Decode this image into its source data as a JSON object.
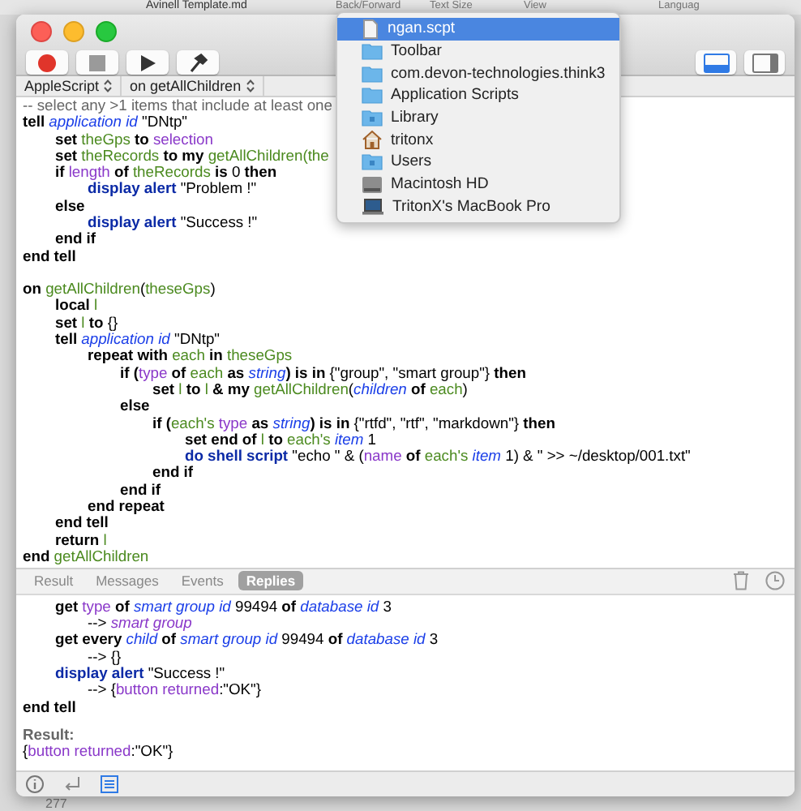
{
  "background_window": {
    "file_name": "Avinell Template.md",
    "toolbar_labels": [
      "Back/Forward",
      "Text Size",
      "View",
      "Languag"
    ],
    "line_number": "277"
  },
  "window": {
    "toolbar_buttons": [
      {
        "kind": "record"
      },
      {
        "kind": "stop"
      },
      {
        "kind": "run"
      },
      {
        "kind": "compile"
      }
    ],
    "view_buttons": [
      {
        "kind": "bottom-pane",
        "selected": true
      },
      {
        "kind": "side-pane",
        "selected": false
      }
    ],
    "selectors": [
      "AppleScript",
      "on getAllChildren"
    ],
    "code": [
      {
        "tokens": [
          {
            "t": "-- select any >1 items that include at least one",
            "kind": "comment"
          }
        ]
      },
      {
        "tokens": [
          {
            "t": "tell ",
            "kind": "kw"
          },
          {
            "t": "application id",
            "kind": "class"
          },
          {
            "t": " \"DNtp\"",
            "kind": "plain"
          }
        ]
      },
      {
        "tokens": [
          {
            "t": "\tset ",
            "kind": "kw"
          },
          {
            "t": "theGps",
            "kind": "var"
          },
          {
            "t": " to ",
            "kind": "kw"
          },
          {
            "t": "selection",
            "kind": "prop"
          }
        ]
      },
      {
        "tokens": [
          {
            "t": "\tset ",
            "kind": "kw"
          },
          {
            "t": "theRecords",
            "kind": "var"
          },
          {
            "t": " to my ",
            "kind": "kw"
          },
          {
            "t": "getAllChildren(the",
            "kind": "var"
          }
        ]
      },
      {
        "tokens": [
          {
            "t": "\tif ",
            "kind": "kw"
          },
          {
            "t": "length",
            "kind": "prop"
          },
          {
            "t": " of ",
            "kind": "kw"
          },
          {
            "t": "theRecords",
            "kind": "var"
          },
          {
            "t": " is ",
            "kind": "kw"
          },
          {
            "t": "0",
            "kind": "plain"
          },
          {
            "t": " then",
            "kind": "kw"
          }
        ]
      },
      {
        "tokens": [
          {
            "t": "\t\tdisplay alert",
            "kind": "cmd"
          },
          {
            "t": " \"Problem !\"",
            "kind": "plain"
          }
        ]
      },
      {
        "tokens": [
          {
            "t": "\telse",
            "kind": "kw"
          }
        ]
      },
      {
        "tokens": [
          {
            "t": "\t\tdisplay alert",
            "kind": "cmd"
          },
          {
            "t": " \"Success !\"",
            "kind": "plain"
          }
        ]
      },
      {
        "tokens": [
          {
            "t": "\tend if",
            "kind": "kw"
          }
        ]
      },
      {
        "tokens": [
          {
            "t": "end tell",
            "kind": "kw"
          }
        ]
      },
      {
        "spaced": true,
        "tokens": [
          {
            "t": "on ",
            "kind": "kw"
          },
          {
            "t": "getAllChildren",
            "kind": "var"
          },
          {
            "t": "(",
            "kind": "plain"
          },
          {
            "t": "theseGps",
            "kind": "var"
          },
          {
            "t": ")",
            "kind": "plain"
          }
        ]
      },
      {
        "tokens": [
          {
            "t": "\tlocal ",
            "kind": "kw"
          },
          {
            "t": "l",
            "kind": "var"
          }
        ]
      },
      {
        "tokens": [
          {
            "t": "\tset ",
            "kind": "kw"
          },
          {
            "t": "l",
            "kind": "var"
          },
          {
            "t": " to ",
            "kind": "kw"
          },
          {
            "t": "{}",
            "kind": "plain"
          }
        ]
      },
      {
        "tokens": [
          {
            "t": "\ttell ",
            "kind": "kw"
          },
          {
            "t": "application id",
            "kind": "class"
          },
          {
            "t": " \"DNtp\"",
            "kind": "plain"
          }
        ]
      },
      {
        "tokens": [
          {
            "t": "\t\trepeat with ",
            "kind": "kw"
          },
          {
            "t": "each",
            "kind": "var"
          },
          {
            "t": " in ",
            "kind": "kw"
          },
          {
            "t": "theseGps",
            "kind": "var"
          }
        ]
      },
      {
        "tokens": [
          {
            "t": "\t\t\tif (",
            "kind": "kw"
          },
          {
            "t": "type",
            "kind": "prop"
          },
          {
            "t": " of ",
            "kind": "kw"
          },
          {
            "t": "each",
            "kind": "var"
          },
          {
            "t": " as ",
            "kind": "kw"
          },
          {
            "t": "string",
            "kind": "class"
          },
          {
            "t": ") is in ",
            "kind": "kw"
          },
          {
            "t": "{\"group\", \"smart group\"}",
            "kind": "plain"
          },
          {
            "t": " then",
            "kind": "kw"
          }
        ]
      },
      {
        "tokens": [
          {
            "t": "\t\t\t\tset ",
            "kind": "kw"
          },
          {
            "t": "l",
            "kind": "var"
          },
          {
            "t": " to ",
            "kind": "kw"
          },
          {
            "t": "l",
            "kind": "var"
          },
          {
            "t": " & my ",
            "kind": "kw"
          },
          {
            "t": "getAllChildren",
            "kind": "var"
          },
          {
            "t": "(",
            "kind": "plain"
          },
          {
            "t": "children",
            "kind": "class"
          },
          {
            "t": " of ",
            "kind": "kw"
          },
          {
            "t": "each",
            "kind": "var"
          },
          {
            "t": ")",
            "kind": "plain"
          }
        ]
      },
      {
        "tokens": [
          {
            "t": "\t\t\telse",
            "kind": "kw"
          }
        ]
      },
      {
        "tokens": [
          {
            "t": "\t\t\t\tif (",
            "kind": "kw"
          },
          {
            "t": "each's",
            "kind": "var"
          },
          {
            "t": " type",
            "kind": "prop"
          },
          {
            "t": " as ",
            "kind": "kw"
          },
          {
            "t": "string",
            "kind": "class"
          },
          {
            "t": ") is in ",
            "kind": "kw"
          },
          {
            "t": "{\"rtfd\", \"rtf\", \"markdown\"}",
            "kind": "plain"
          },
          {
            "t": " then",
            "kind": "kw"
          }
        ]
      },
      {
        "tokens": [
          {
            "t": "\t\t\t\t\tset end of ",
            "kind": "kw"
          },
          {
            "t": "l",
            "kind": "var"
          },
          {
            "t": " to ",
            "kind": "kw"
          },
          {
            "t": "each's",
            "kind": "var"
          },
          {
            "t": " item",
            "kind": "class"
          },
          {
            "t": " 1",
            "kind": "plain"
          }
        ]
      },
      {
        "tokens": [
          {
            "t": "\t\t\t\t\tdo shell script",
            "kind": "cmd"
          },
          {
            "t": " \"echo \" & (",
            "kind": "plain"
          },
          {
            "t": "name",
            "kind": "prop"
          },
          {
            "t": " of ",
            "kind": "kw"
          },
          {
            "t": "each's",
            "kind": "var"
          },
          {
            "t": " item",
            "kind": "class"
          },
          {
            "t": " 1) & \" >> ~/desktop/001.txt\"",
            "kind": "plain"
          }
        ]
      },
      {
        "tokens": [
          {
            "t": "\t\t\t\tend if",
            "kind": "kw"
          }
        ]
      },
      {
        "tokens": [
          {
            "t": "\t\t\tend if",
            "kind": "kw"
          }
        ]
      },
      {
        "tokens": [
          {
            "t": "\t\tend repeat",
            "kind": "kw"
          }
        ]
      },
      {
        "tokens": [
          {
            "t": "\tend tell",
            "kind": "kw"
          }
        ]
      },
      {
        "tokens": [
          {
            "t": "\treturn ",
            "kind": "kw"
          },
          {
            "t": "l",
            "kind": "var"
          }
        ]
      },
      {
        "tokens": [
          {
            "t": "end ",
            "kind": "kw"
          },
          {
            "t": "getAllChildren",
            "kind": "var"
          }
        ]
      }
    ],
    "log_tabs": [
      {
        "label": "Result",
        "selected": false
      },
      {
        "label": "Messages",
        "selected": false
      },
      {
        "label": "Events",
        "selected": false
      },
      {
        "label": "Replies",
        "selected": true
      }
    ],
    "log": [
      {
        "tokens": [
          {
            "t": "\tget ",
            "kind": "kw"
          },
          {
            "t": "type",
            "kind": "prop"
          },
          {
            "t": " of ",
            "kind": "kw"
          },
          {
            "t": "smart group id",
            "kind": "class"
          },
          {
            "t": " 99494",
            "kind": "plain"
          },
          {
            "t": " of ",
            "kind": "kw"
          },
          {
            "t": "database id",
            "kind": "class"
          },
          {
            "t": " 3",
            "kind": "plain"
          }
        ]
      },
      {
        "tokens": [
          {
            "t": "\t\t--> ",
            "kind": "plain"
          },
          {
            "t": "smart group",
            "kind": "enum"
          }
        ]
      },
      {
        "tokens": [
          {
            "t": "\tget every ",
            "kind": "kw"
          },
          {
            "t": "child",
            "kind": "class"
          },
          {
            "t": " of ",
            "kind": "kw"
          },
          {
            "t": "smart group id",
            "kind": "class"
          },
          {
            "t": " 99494",
            "kind": "plain"
          },
          {
            "t": " of ",
            "kind": "kw"
          },
          {
            "t": "database id",
            "kind": "class"
          },
          {
            "t": " 3",
            "kind": "plain"
          }
        ]
      },
      {
        "tokens": [
          {
            "t": "\t\t--> {}",
            "kind": "plain"
          }
        ]
      },
      {
        "tokens": [
          {
            "t": "\tdisplay alert",
            "kind": "cmd"
          },
          {
            "t": " \"Success !\"",
            "kind": "plain"
          }
        ]
      },
      {
        "tokens": [
          {
            "t": "\t\t--> {",
            "kind": "plain"
          },
          {
            "t": "button returned",
            "kind": "prop"
          },
          {
            "t": ":\"OK\"}",
            "kind": "plain"
          }
        ]
      },
      {
        "tokens": [
          {
            "t": "end tell",
            "kind": "kw"
          }
        ]
      }
    ],
    "result_label": "Result:",
    "result": [
      {
        "t": "{",
        "kind": "plain"
      },
      {
        "t": "button returned",
        "kind": "prop"
      },
      {
        "t": ":\"OK\"}",
        "kind": "plain"
      }
    ],
    "bottom_buttons": [
      {
        "kind": "info",
        "selected": false
      },
      {
        "kind": "return",
        "selected": false
      },
      {
        "kind": "list",
        "selected": true
      }
    ]
  },
  "path_menu": [
    {
      "label": "ngan.scpt",
      "kind": "file",
      "selected": true
    },
    {
      "label": "Toolbar",
      "kind": "folder",
      "selected": false
    },
    {
      "label": "com.devon-technologies.think3",
      "kind": "folder",
      "selected": false
    },
    {
      "label": "Application Scripts",
      "kind": "folder",
      "selected": false
    },
    {
      "label": "Library",
      "kind": "library",
      "selected": false
    },
    {
      "label": "tritonx",
      "kind": "home",
      "selected": false
    },
    {
      "label": "Users",
      "kind": "users",
      "selected": false
    },
    {
      "label": "Macintosh HD",
      "kind": "disk",
      "selected": false
    },
    {
      "label": "TritonX's MacBook Pro",
      "kind": "laptop",
      "selected": false
    }
  ]
}
